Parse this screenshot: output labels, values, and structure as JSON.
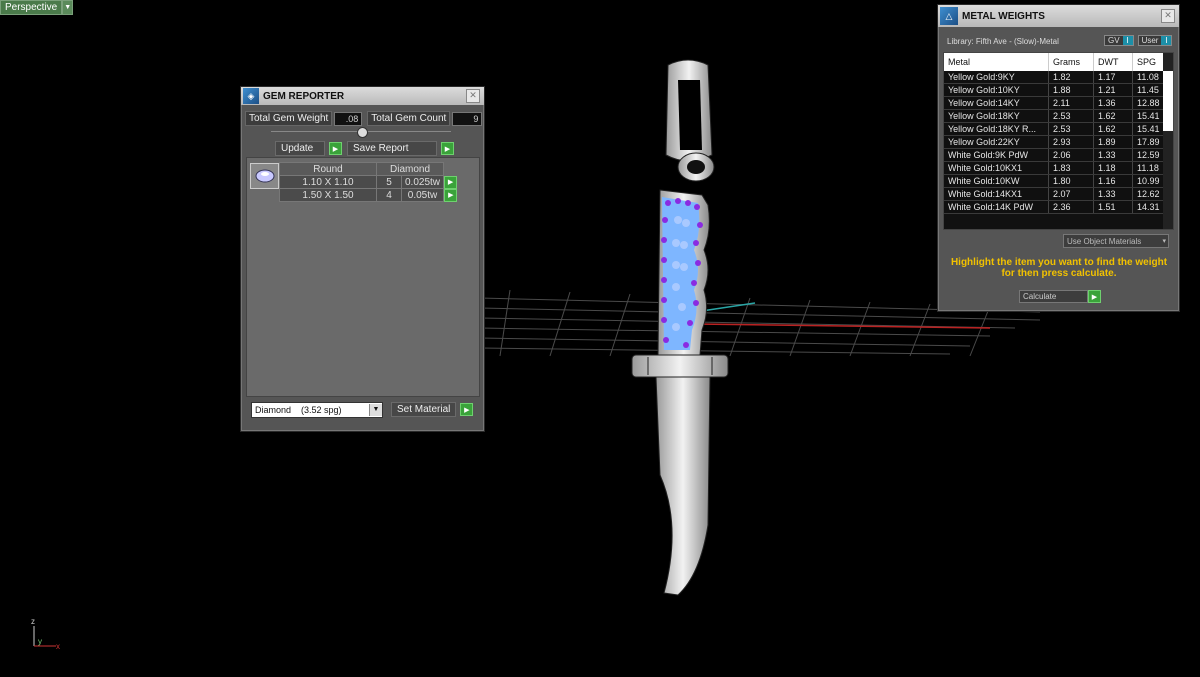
{
  "viewport": {
    "label": "Perspective"
  },
  "gem_reporter": {
    "title": "GEM REPORTER",
    "total_weight_label": "Total Gem Weight",
    "total_weight_value": ".08",
    "total_count_label": "Total Gem Count",
    "total_count_value": "9",
    "update_label": "Update",
    "save_report_label": "Save Report",
    "table": {
      "headers": [
        "Round",
        "Diamond"
      ],
      "rows": [
        {
          "size": "1.10 X 1.10",
          "count": "5",
          "weight": "0.025tw"
        },
        {
          "size": "1.50 X 1.50",
          "count": "4",
          "weight": "0.05tw"
        }
      ]
    },
    "material_select": "Diamond    (3.52 spg)",
    "set_material_label": "Set Material"
  },
  "metal_weights": {
    "title": "METAL WEIGHTS",
    "library": "Library: Fifth Ave - (Slow)-Metal",
    "gv_label": "GV",
    "user_label": "User",
    "columns": [
      "Metal",
      "Grams",
      "DWT",
      "SPG"
    ],
    "rows": [
      [
        "Yellow Gold:9KY",
        "1.82",
        "1.17",
        "11.08"
      ],
      [
        "Yellow Gold:10KY",
        "1.88",
        "1.21",
        "11.45"
      ],
      [
        "Yellow Gold:14KY",
        "2.11",
        "1.36",
        "12.88"
      ],
      [
        "Yellow Gold:18KY",
        "2.53",
        "1.62",
        "15.41"
      ],
      [
        "Yellow Gold:18KY R...",
        "2.53",
        "1.62",
        "15.41"
      ],
      [
        "Yellow Gold:22KY",
        "2.93",
        "1.89",
        "17.89"
      ],
      [
        "White Gold:9K PdW",
        "2.06",
        "1.33",
        "12.59"
      ],
      [
        "White Gold:10KX1",
        "1.83",
        "1.18",
        "11.18"
      ],
      [
        "White Gold:10KW",
        "1.80",
        "1.16",
        "10.99"
      ],
      [
        "White Gold:14KX1",
        "2.07",
        "1.33",
        "12.62"
      ],
      [
        "White Gold:14K PdW",
        "2.36",
        "1.51",
        "14.31"
      ]
    ],
    "use_object_materials": "Use Object Materials",
    "instruction": "Highlight the item you want to find the weight for then press calculate.",
    "calculate_label": "Calculate"
  },
  "axis": {
    "z": "z",
    "y": "y",
    "x": "x"
  }
}
